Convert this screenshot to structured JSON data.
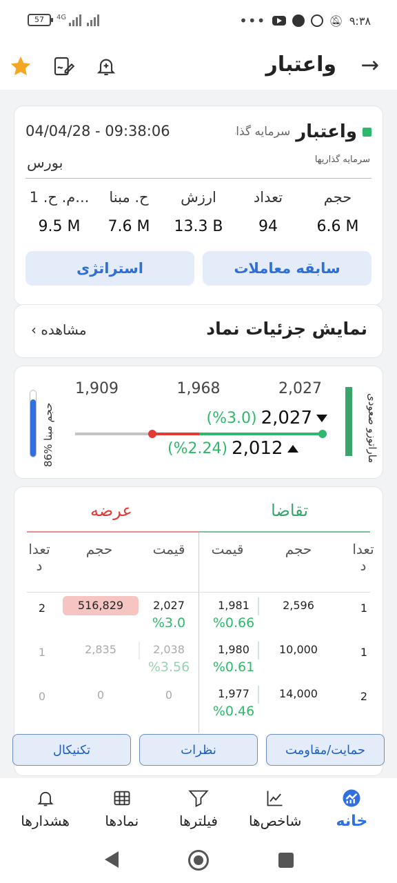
{
  "status_bar": {
    "battery": "57",
    "network": "4G",
    "dots": "•••",
    "time": "۹:۳۸"
  },
  "app_bar": {
    "title": "واعتبار",
    "back_icon": "arrow-right-icon"
  },
  "summary": {
    "symbol": "واعتبار",
    "full_name": "سرمایه گذاری اعتبار ایران",
    "datetime": "04/04/28 - 09:38:06",
    "group": "سرمایه گذاریها",
    "market": "بورس",
    "stats": [
      {
        "label": "حجم",
        "value": "6.6 M"
      },
      {
        "label": "تعداد",
        "value": "94"
      },
      {
        "label": "ارزش",
        "value": "13.3 B"
      },
      {
        "label": "ح. مبنا",
        "value": "7.6 M"
      },
      {
        "label": "م. ح. 1...",
        "value": "9.5 M"
      }
    ],
    "btn_trades": "سابقه معاملات",
    "btn_strategy": "استراتژی"
  },
  "details": {
    "title": "نمایش جزئیات نماد",
    "view": "مشاهده"
  },
  "range": {
    "buyer_power": "ماراتوزو صعودی",
    "top_prices": [
      "1,909",
      "1,968",
      "2,027"
    ],
    "high": "2,027",
    "high_pct": "(%3.0)",
    "low": "2,012",
    "low_pct": "(%2.24)",
    "volume_label": "86% حجم مبنا",
    "volume_pct": 86
  },
  "order_book": {
    "bid_title": "تقاضا",
    "ask_title": "عرضه",
    "headers": {
      "count": "تعدا د",
      "volume": "حجم",
      "price": "قیمت"
    },
    "rows": [
      {
        "bid_count": "1",
        "bid_vol": "2,596",
        "bid_price": "1,981",
        "bid_pct": "%0.66",
        "ask_price": "2,027",
        "ask_pct": "%3.0",
        "ask_vol": "516,829",
        "ask_count": "2"
      },
      {
        "bid_count": "1",
        "bid_vol": "10,000",
        "bid_price": "1,980",
        "bid_pct": "%0.61",
        "ask_price": "2,038",
        "ask_pct": "%3.56",
        "ask_vol": "2,835",
        "ask_count": "1"
      },
      {
        "bid_count": "2",
        "bid_vol": "14,000",
        "bid_price": "1,977",
        "bid_pct": "%0.46",
        "ask_price": "0",
        "ask_pct": "",
        "ask_vol": "0",
        "ask_count": "0"
      }
    ]
  },
  "bottom_buttons": [
    "حمایت/مقاومت",
    "نظرات",
    "تکنیکال"
  ],
  "nav": [
    {
      "label": "خانه",
      "icon": "home-icon"
    },
    {
      "label": "شاخص‌ها",
      "icon": "chart-icon"
    },
    {
      "label": "فیلترها",
      "icon": "filter-icon"
    },
    {
      "label": "نمادها",
      "icon": "grid-icon"
    },
    {
      "label": "هشدارها",
      "icon": "bell-icon"
    }
  ]
}
